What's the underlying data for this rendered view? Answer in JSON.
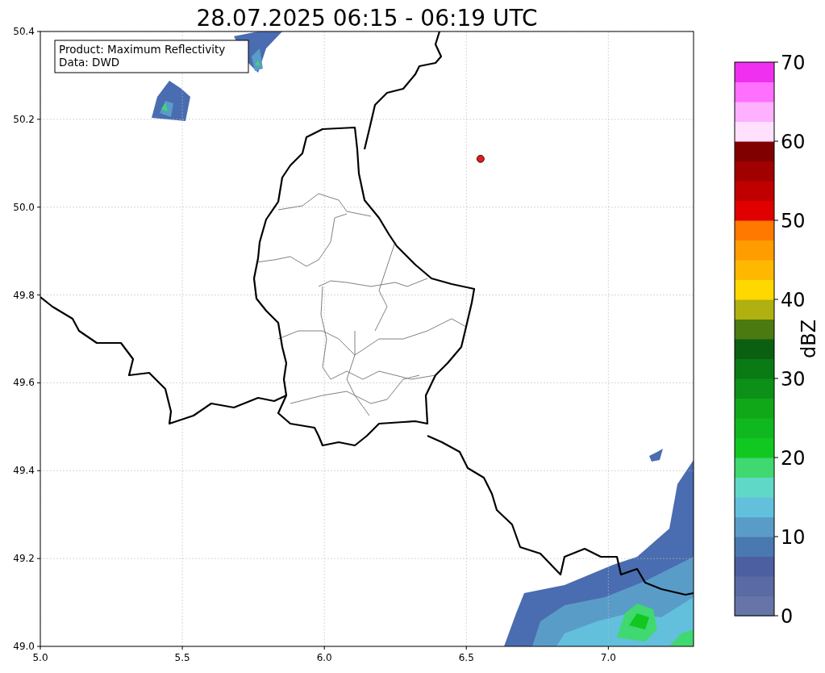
{
  "figure": {
    "info_box": [
      "Product: Maximum Reflectivity",
      "Data: DWD"
    ],
    "chart_data": {
      "type": "scatter",
      "title": "28.07.2025 06:15 - 06:19 UTC",
      "x": [
        6.55
      ],
      "series": [
        {
          "color": "#e41a1c",
          "values": [
            50.11
          ]
        }
      ],
      "grid": true,
      "xlim": [
        5.0,
        7.3
      ],
      "ylim": [
        49.0,
        50.4
      ],
      "xticks": [
        {
          "value": 5,
          "label": "5.0"
        },
        {
          "value": 5.5,
          "label": "5.5"
        },
        {
          "value": 6,
          "label": "6.0"
        },
        {
          "value": 6.5,
          "label": "6.5"
        },
        {
          "value": 7,
          "label": "7.0"
        }
      ],
      "yticks": [
        {
          "value": 49,
          "label": "49.0"
        },
        {
          "value": 49.2,
          "label": "49.2"
        },
        {
          "value": 49.4,
          "label": "49.4"
        },
        {
          "value": 49.6,
          "label": "49.6"
        },
        {
          "value": 49.8,
          "label": "49.8"
        },
        {
          "value": 50,
          "label": "50.0"
        },
        {
          "value": 50.2,
          "label": "50.2"
        },
        {
          "value": 50.4,
          "label": "50.4"
        }
      ]
    },
    "colorbar": {
      "label": "dBZ",
      "ticks": [
        "70",
        "60",
        "50",
        "40",
        "30",
        "20",
        "10",
        "0"
      ]
    }
  }
}
